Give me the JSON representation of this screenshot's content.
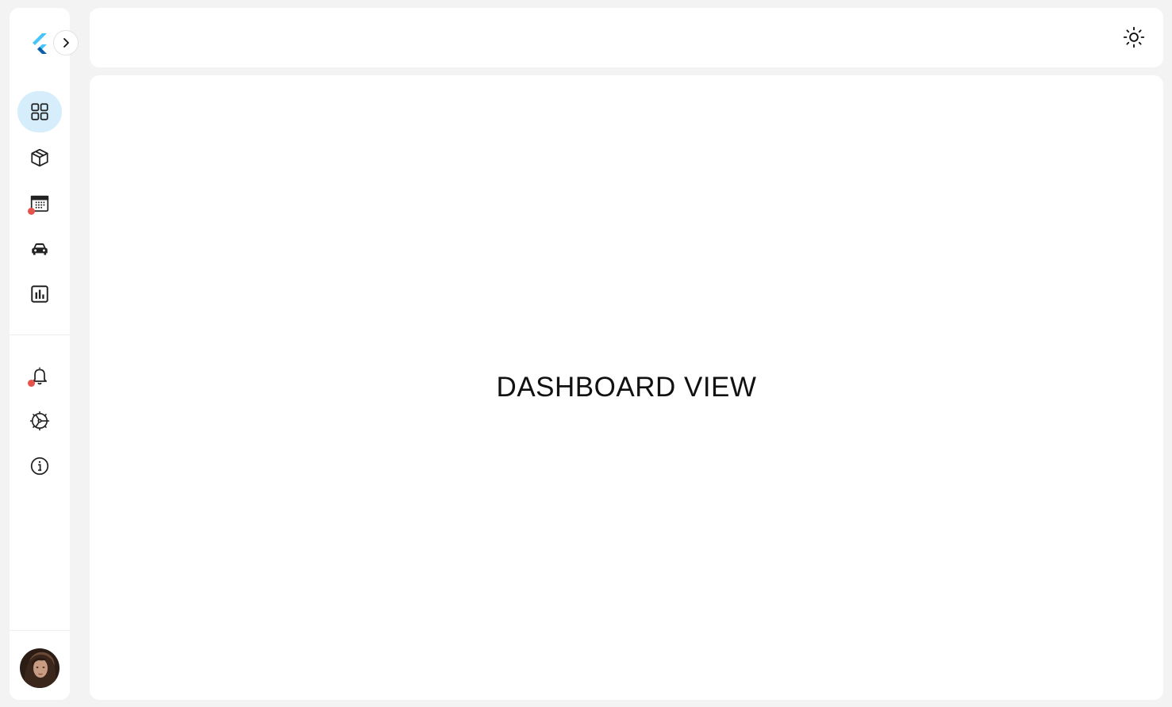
{
  "sidebar": {
    "logo_icon": "flutter-logo-icon",
    "expand_icon": "chevron-right-icon",
    "nav_items": [
      {
        "id": "dashboard",
        "icon": "grid-icon",
        "active": true,
        "badge": false
      },
      {
        "id": "products",
        "icon": "box-icon",
        "active": false,
        "badge": false
      },
      {
        "id": "calendar",
        "icon": "calendar-icon",
        "active": false,
        "badge": true
      },
      {
        "id": "vehicles",
        "icon": "car-icon",
        "active": false,
        "badge": false
      },
      {
        "id": "reports",
        "icon": "bar-chart-icon",
        "active": false,
        "badge": false
      }
    ],
    "secondary_items": [
      {
        "id": "notifications",
        "icon": "bell-icon",
        "badge": true
      },
      {
        "id": "settings",
        "icon": "gear-icon",
        "badge": false
      },
      {
        "id": "info",
        "icon": "info-icon",
        "badge": false
      }
    ],
    "avatar_icon": "user-avatar"
  },
  "topbar": {
    "theme_icon": "sun-icon"
  },
  "main": {
    "title": "DASHBOARD VIEW"
  },
  "colors": {
    "background": "#f3f3f3",
    "panel": "#ffffff",
    "active_pill": "#d6eefc",
    "badge": "#e5534b",
    "flutter_light": "#47c5fb",
    "flutter_dark": "#0b5ea8"
  }
}
